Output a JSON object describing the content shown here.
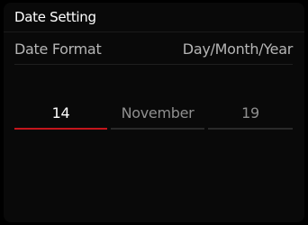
{
  "header": {
    "title": "Date Setting"
  },
  "date_format": {
    "label": "Date Format",
    "value": "Day/Month/Year"
  },
  "date_picker": {
    "day": "14",
    "month": "November",
    "year": "19",
    "selected_field": "day"
  },
  "colors": {
    "background": "#000000",
    "active_underline": "#c4161c",
    "text_primary": "#ffffff",
    "text_secondary": "#b5b5b5"
  }
}
